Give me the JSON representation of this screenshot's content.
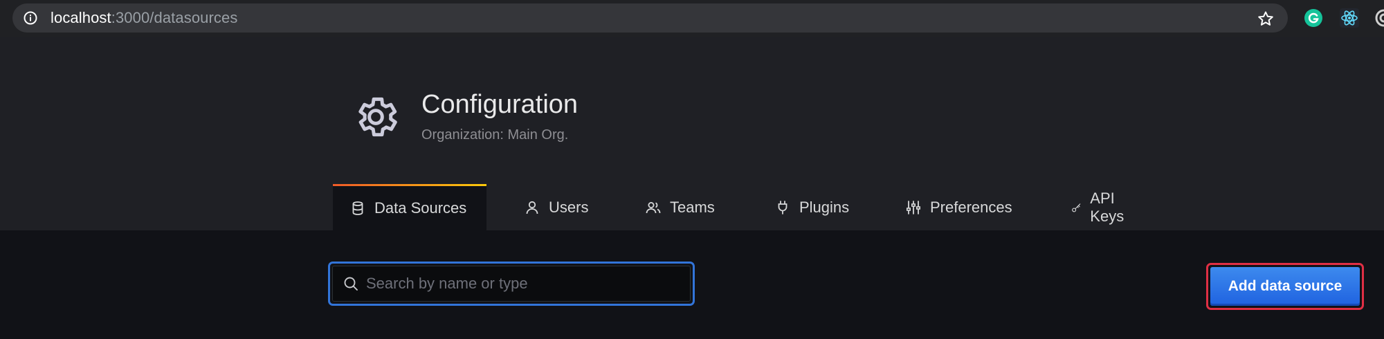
{
  "browser": {
    "url_host": "localhost",
    "url_rest": ":3000/datasources",
    "icons": [
      "info-icon",
      "star-icon",
      "grammarly-extension-icon",
      "react-devtools-extension-icon",
      "extension-icon"
    ]
  },
  "header": {
    "icon": "gear-icon",
    "title": "Configuration",
    "subtitle": "Organization: Main Org."
  },
  "tabs": [
    {
      "label": "Data Sources",
      "icon": "database-icon",
      "active": true
    },
    {
      "label": "Users",
      "icon": "user-icon",
      "active": false
    },
    {
      "label": "Teams",
      "icon": "users-icon",
      "active": false
    },
    {
      "label": "Plugins",
      "icon": "plug-icon",
      "active": false
    },
    {
      "label": "Preferences",
      "icon": "sliders-icon",
      "active": false
    },
    {
      "label": "API Keys",
      "icon": "key-icon",
      "active": false
    }
  ],
  "search": {
    "placeholder": "Search by name or type",
    "value": ""
  },
  "actions": {
    "add_label": "Add data source"
  },
  "colors": {
    "accent_blue": "#3274d9",
    "highlight_red": "#e02f44",
    "tab_gradient_start": "#f05a28",
    "tab_gradient_end": "#fbca0a"
  }
}
